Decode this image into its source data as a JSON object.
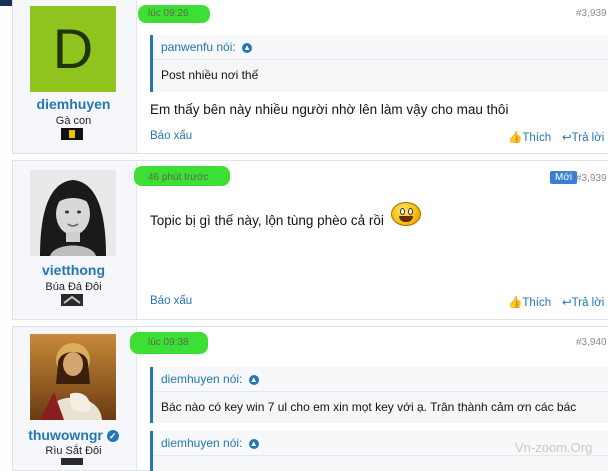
{
  "posts": [
    {
      "user": {
        "name": "diemhuyen",
        "title": "Gà con",
        "avatar_letter": "D",
        "avatar_color": "#8fc41f"
      },
      "time": "lúc 09:26",
      "number": "#3,939",
      "quote": {
        "author": "panwenfu nói:",
        "text": "Post nhiều nơi thế"
      },
      "message": "Em thấy bên này nhiều người nhờ lên làm vậy cho mau thôi",
      "actions": {
        "report": "Báo xấu",
        "like": "Thích",
        "reply": "Trả lời"
      }
    },
    {
      "user": {
        "name": "vietthong",
        "title": "Búa Đá Đôi"
      },
      "time": "46 phút trước",
      "badge": "Mới",
      "number": "#3,939",
      "message": "Topic bị gì thế này, lộn tùng phèo cả rồi",
      "actions": {
        "report": "Báo xấu",
        "like": "Thích",
        "reply": "Trả lời"
      }
    },
    {
      "user": {
        "name": "thuwowngr",
        "title": "Rìu Sắt Đôi"
      },
      "time": "lúc 09:38",
      "number": "#3,940",
      "quotes": [
        {
          "author": "diemhuyen nói:",
          "text": "Bác nào có key win 7 ul cho em xin mọt key với ạ. Trân thành cảm ơn các bác"
        },
        {
          "author": "diemhuyen nói:"
        }
      ]
    }
  ],
  "watermark": "Vn-zoom.Org",
  "colors": {
    "link": "#2577b1",
    "highlight": "#33dd2a",
    "header": "#183254"
  }
}
